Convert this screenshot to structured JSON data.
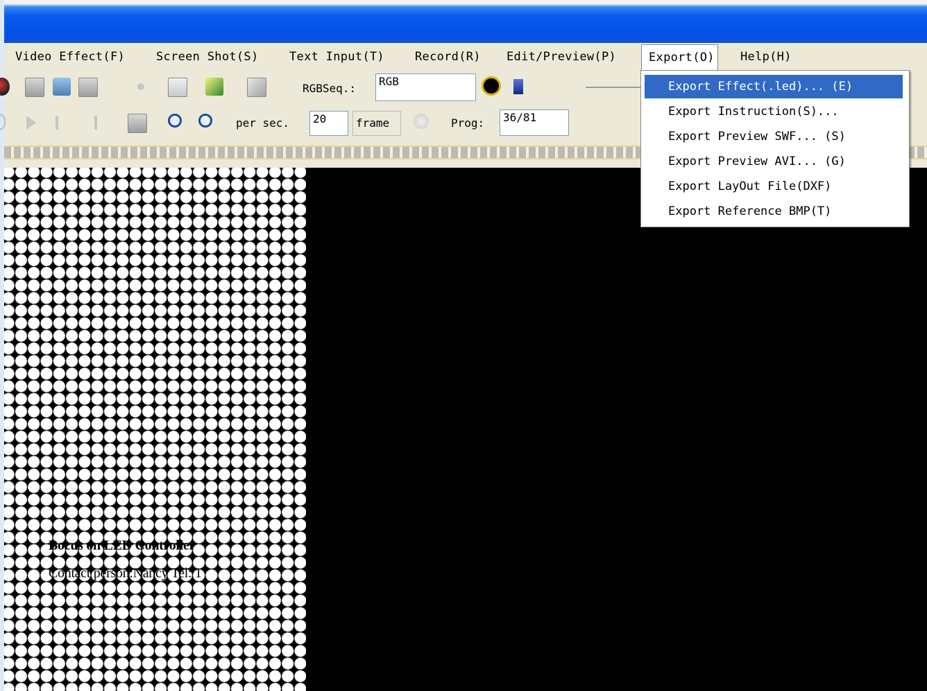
{
  "menubar": {
    "items": [
      {
        "label": "Video Effect(F)"
      },
      {
        "label": "Screen Shot(S)"
      },
      {
        "label": "Text Input(T)"
      },
      {
        "label": "Record(R)"
      },
      {
        "label": "Edit/Preview(P)"
      },
      {
        "label": "Export(O)"
      },
      {
        "label": "Help(H)"
      }
    ]
  },
  "toolbar1": {
    "rgb_label": "RGBSeq.:",
    "rgb_value": "RGB"
  },
  "toolbar2": {
    "per_sec_label": "per sec.",
    "fps_value": "20",
    "frame_label": "frame",
    "prog_label": "Prog:",
    "prog_value": "36/81"
  },
  "export_menu": {
    "items": [
      {
        "label": "Export Effect(.led)... (E)"
      },
      {
        "label": "Export Instruction(S)..."
      },
      {
        "label": "Export Preview SWF... (S)"
      },
      {
        "label": "Export Preview AVI... (G)"
      },
      {
        "label": "Export LayOut File(DXF)"
      },
      {
        "label": "Export Reference BMP(T)"
      }
    ]
  },
  "canvas": {
    "title_text": "Bocus on LED Controller",
    "contact_text": "Contact person:Nancy    Tel: 1"
  },
  "colors": {
    "titlebar": "#0a5cf0",
    "highlight": "#316ac5",
    "toolbar_bg": "#ece9d8"
  }
}
